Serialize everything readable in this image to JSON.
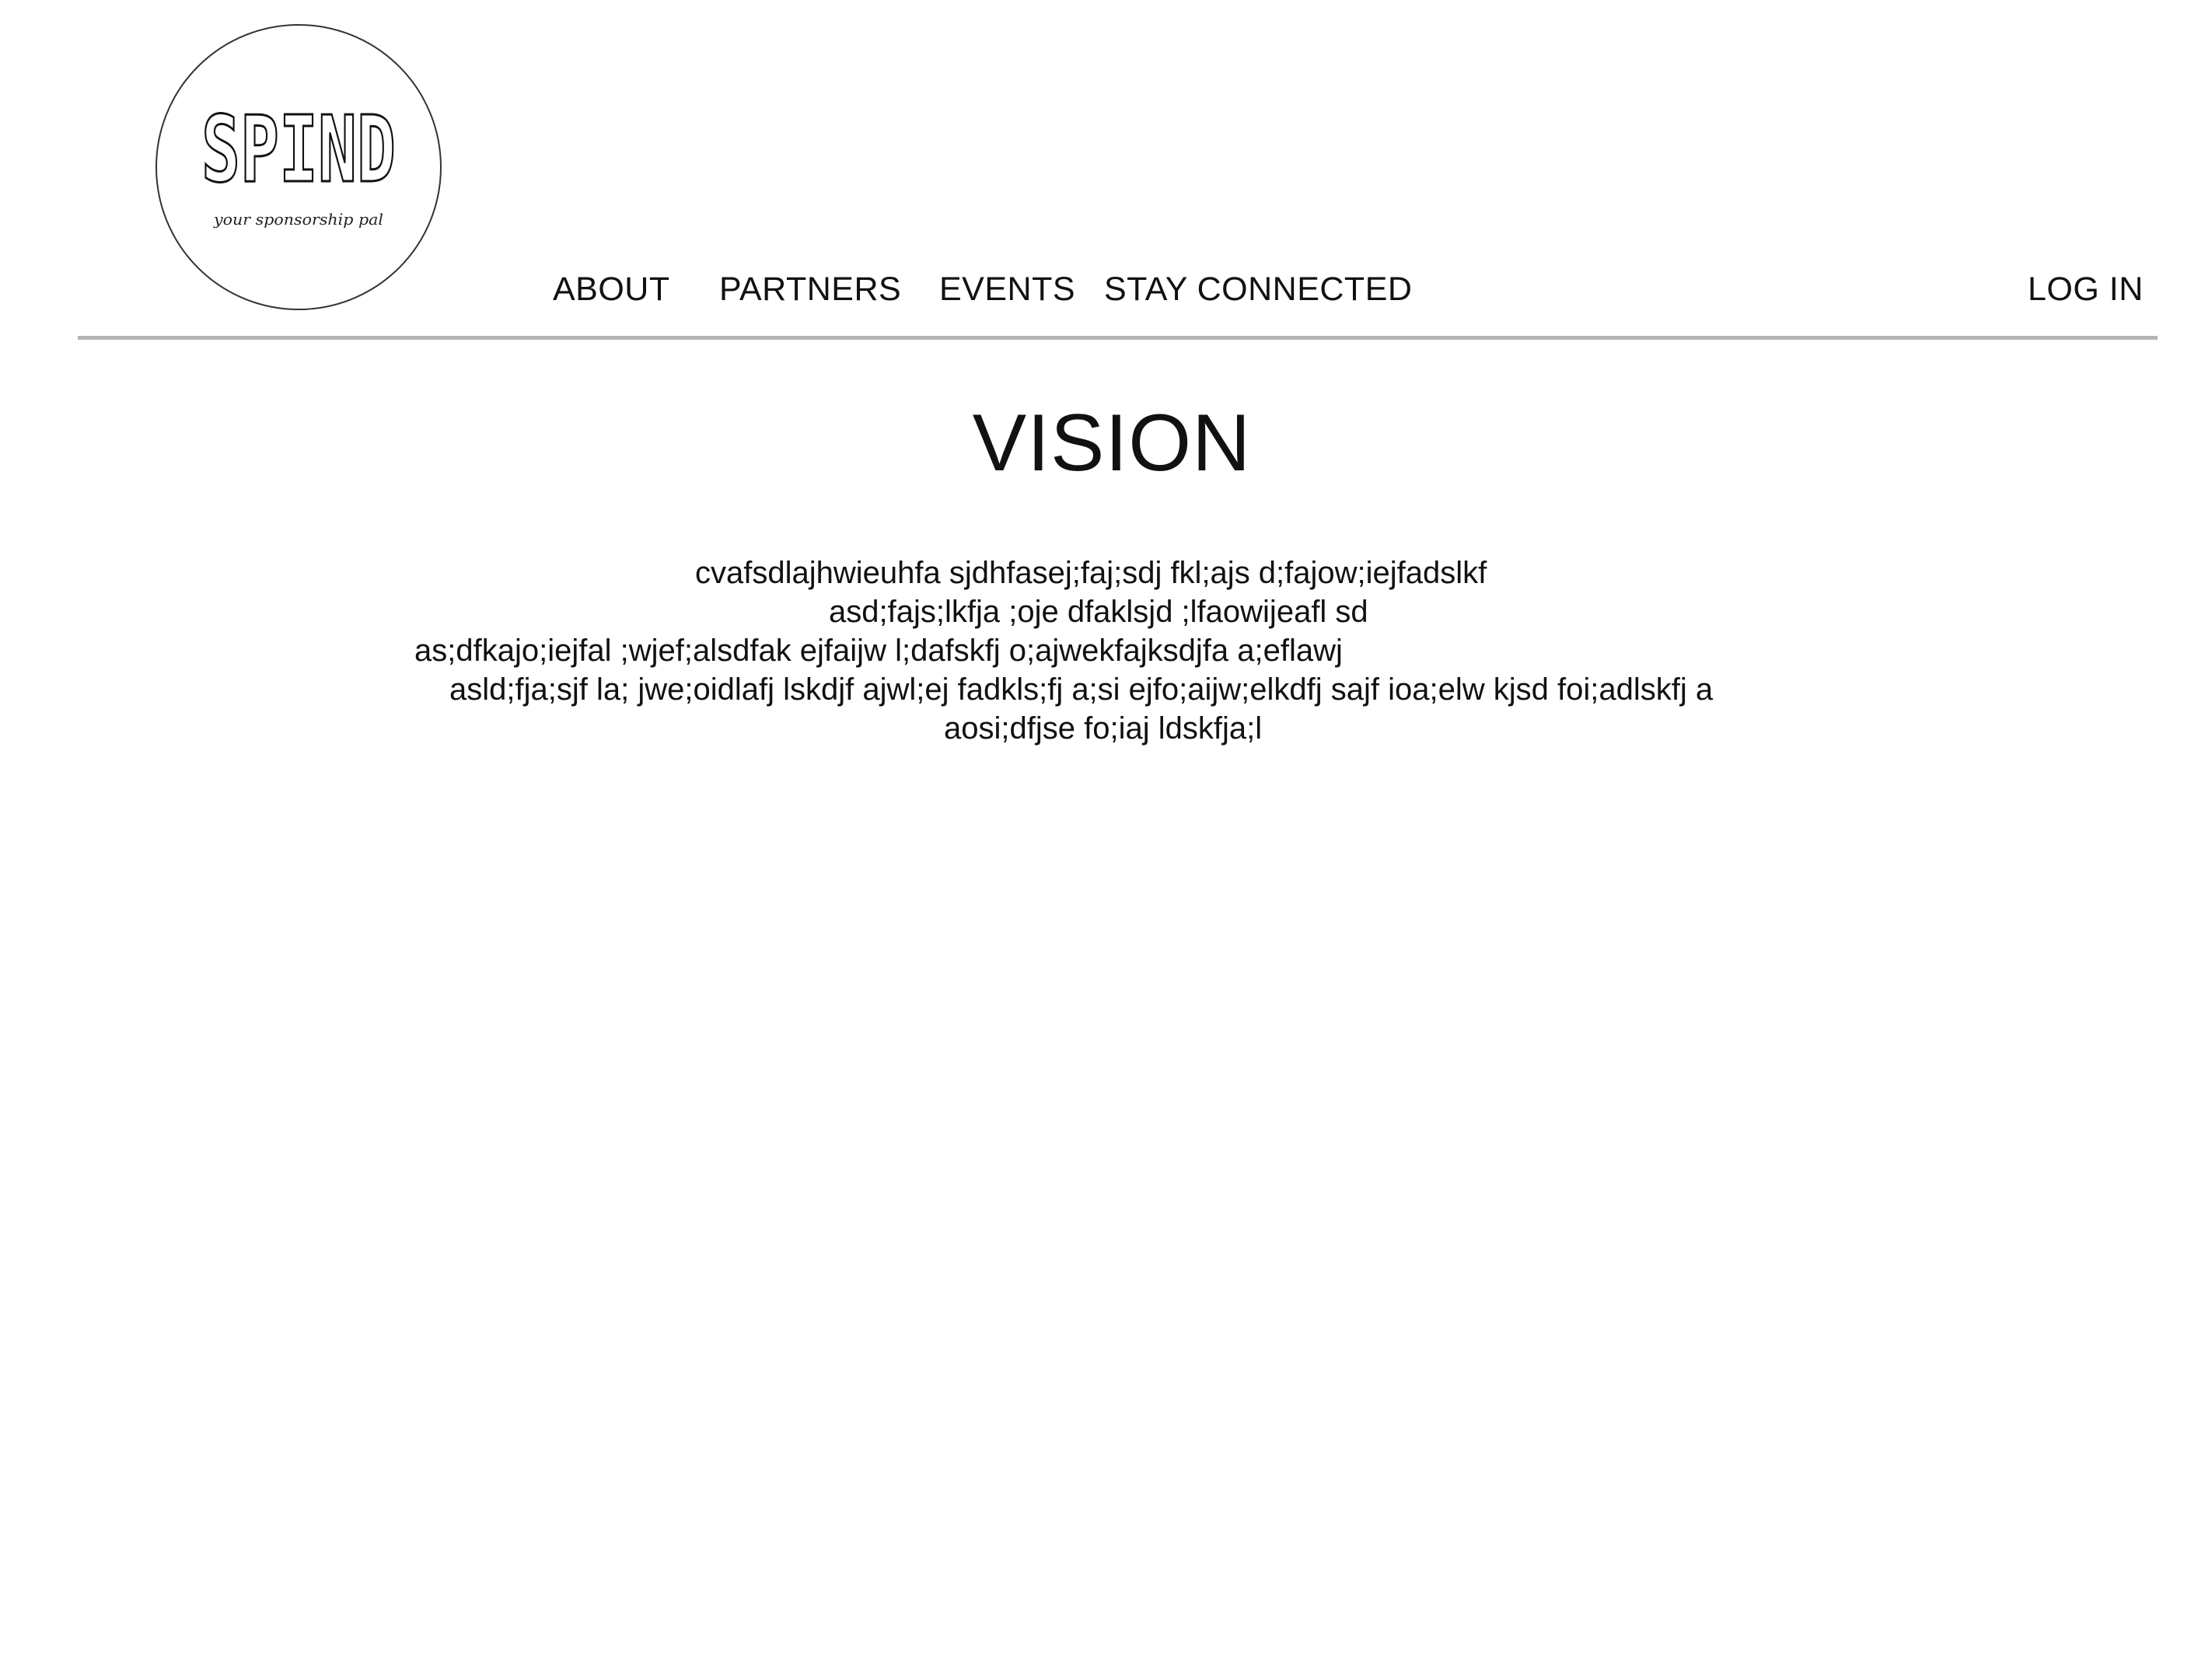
{
  "logo": {
    "wordmark": "SPIND",
    "tagline": "your sponsorship pal"
  },
  "nav": {
    "items": [
      {
        "label": "ABOUT"
      },
      {
        "label": "PARTNERS"
      },
      {
        "label": "EVENTS"
      },
      {
        "label": "STAY CONNECTED"
      }
    ],
    "login_label": "LOG IN"
  },
  "main": {
    "title": "VISION",
    "lines": [
      "cvafsdlajhwieuhfa sjdhfasej;faj;sdj fkl;ajs d;fajow;iejfadslkf",
      "asd;fajs;lkfja ;oje dfaklsjd ;lfaowijeafl sd",
      "as;dfkajo;iejfal ;wjef;alsdfak ejfaijw l;dafskfj o;ajwekfajksdjfa a;eflawj",
      "asld;fja;sjf la; jwe;oidlafj lskdjf ajwl;ej fadkls;fj a;si ejfo;aijw;elkdfj sajf ioa;elw kjsd foi;adlskfj a",
      "aosi;dfjse fo;iaj ldskfja;l"
    ]
  },
  "colors": {
    "background": "#ffffff",
    "text": "#111111",
    "divider": "#b4b4b4",
    "logo_outline": "#333333"
  }
}
